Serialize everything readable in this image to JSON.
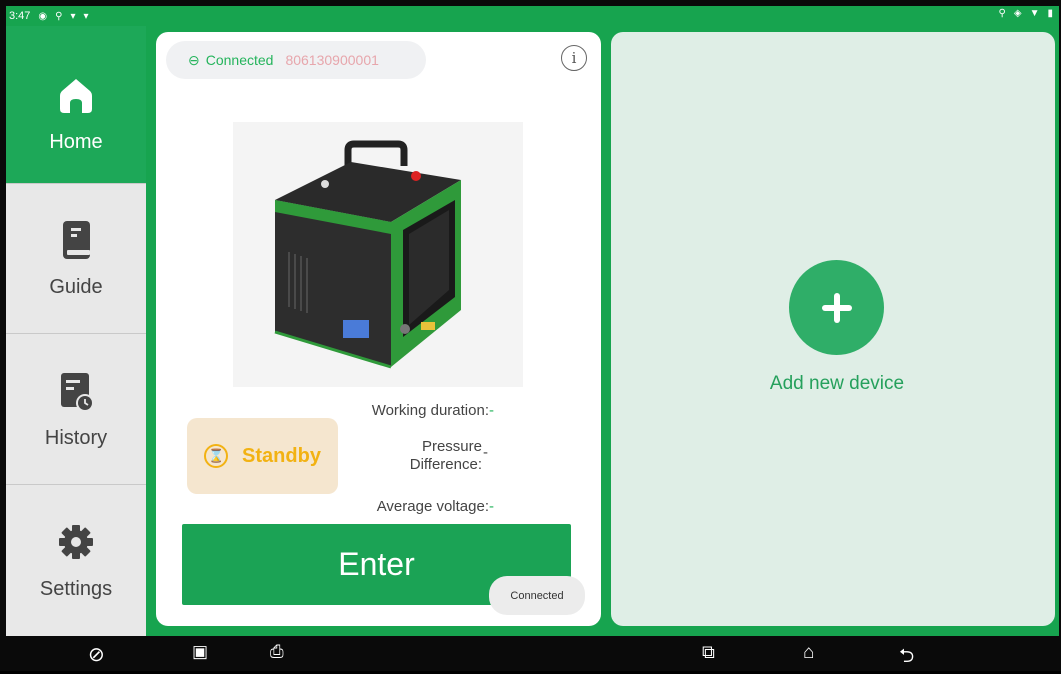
{
  "status_bar": {
    "time": "3:47",
    "left_icons": [
      "settings-badge-icon",
      "location-icon",
      "shield-icon",
      "shield-icon"
    ],
    "right_icons": [
      "location-icon",
      "vibrate-icon",
      "wifi-icon",
      "battery-icon"
    ]
  },
  "sidebar": {
    "items": [
      {
        "label": "Home",
        "icon": "home-icon",
        "active": true
      },
      {
        "label": "Guide",
        "icon": "book-icon",
        "active": false
      },
      {
        "label": "History",
        "icon": "history-icon",
        "active": false
      },
      {
        "label": "Settings",
        "icon": "gear-icon",
        "active": false
      }
    ]
  },
  "device_card": {
    "connection_label": "Connected",
    "serial": "806130900001",
    "status_label": "Standby",
    "metrics": {
      "working_duration_label": "Working duration:",
      "working_duration_value": "-",
      "pressure_label_line1": "Pressure",
      "pressure_label_line2": "Difference:",
      "pressure_value": "-",
      "voltage_label": "Average voltage:",
      "voltage_value": "-"
    },
    "enter_label": "Enter",
    "toast": "Connected"
  },
  "add_device": {
    "label": "Add new device"
  },
  "colors": {
    "brand_green": "#1ba355",
    "standby_yellow": "#f2b213",
    "serial_pink": "#e7a6ac",
    "panel_bg": "#dfeee6"
  }
}
